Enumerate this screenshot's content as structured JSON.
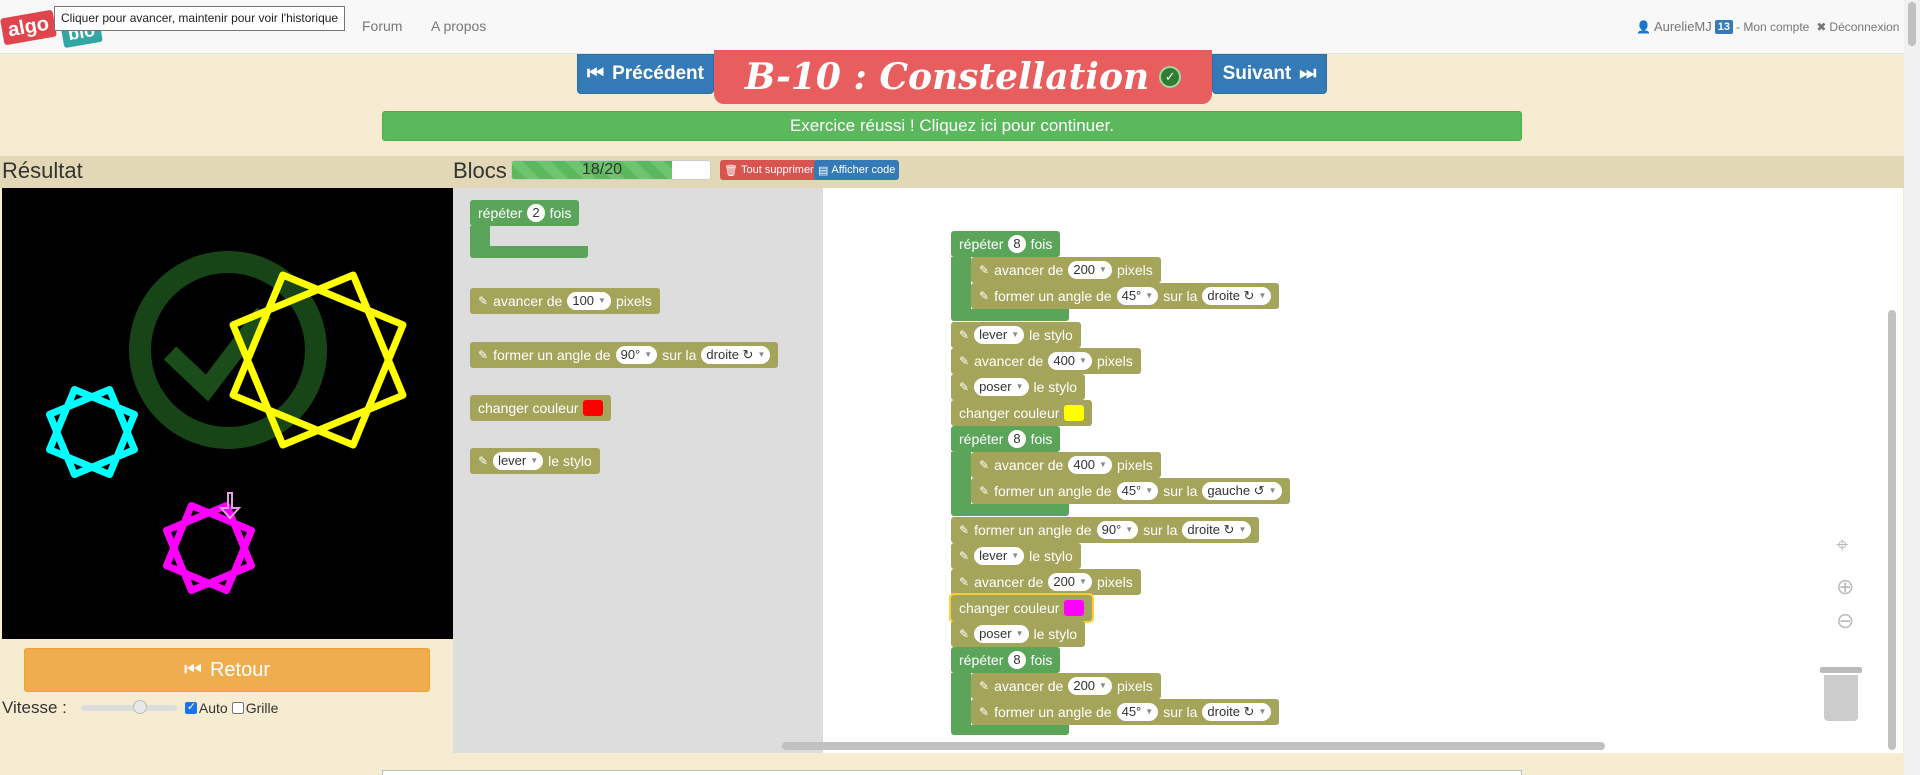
{
  "navbar": {
    "logo_text_1": "algo",
    "logo_text_2": "bio",
    "tooltip": "Cliquer pour avancer, maintenir pour voir l'historique",
    "links": [
      "Forum",
      "A propos"
    ],
    "username": "AurelieMJ",
    "badge": "13",
    "account": "- Mon compte",
    "logout": "Déconnexion"
  },
  "header": {
    "prev": "Précédent",
    "next": "Suivant",
    "title": "B-10 : Constellation",
    "success": "Exercice réussi ! Cliquez ici pour continuer."
  },
  "result": {
    "title": "Résultat",
    "back": "Retour",
    "speed_label": "Vitesse :",
    "auto_label": "Auto",
    "auto_checked": true,
    "grid_label": "Grille",
    "grid_checked": false
  },
  "blocks": {
    "title": "Blocs",
    "progress_text": "18/20",
    "progress_value": 0.9,
    "delete_all": "Tout supprimer",
    "show_code": "Afficher code"
  },
  "toolbox": {
    "repeat": {
      "label": "répéter",
      "count": "2",
      "suffix": "fois"
    },
    "advance": {
      "label": "avancer de",
      "value": "100",
      "unit": "pixels"
    },
    "turn": {
      "label": "former un angle de",
      "angle": "90°",
      "mid": "sur la",
      "dir": "droite ↻"
    },
    "color": {
      "label": "changer couleur",
      "color": "#ff0000"
    },
    "pen": {
      "value": "lever",
      "label": "le stylo"
    }
  },
  "workspace": {
    "r1": {
      "label": "répéter",
      "count": "8",
      "suffix": "fois"
    },
    "r1_adv": {
      "label": "avancer de",
      "value": "200",
      "unit": "pixels"
    },
    "r1_turn": {
      "label": "former un angle de",
      "angle": "45°",
      "mid": "sur la",
      "dir": "droite ↻"
    },
    "pen1": {
      "value": "lever",
      "label": "le stylo"
    },
    "adv1": {
      "label": "avancer de",
      "value": "400",
      "unit": "pixels"
    },
    "pen2": {
      "value": "poser",
      "label": "le stylo"
    },
    "color1": {
      "label": "changer couleur",
      "color": "#ffff00"
    },
    "r2": {
      "label": "répéter",
      "count": "8",
      "suffix": "fois"
    },
    "r2_adv": {
      "label": "avancer de",
      "value": "400",
      "unit": "pixels"
    },
    "r2_turn": {
      "label": "former un angle de",
      "angle": "45°",
      "mid": "sur la",
      "dir": "gauche ↺"
    },
    "turn2": {
      "label": "former un angle de",
      "angle": "90°",
      "mid": "sur la",
      "dir": "droite ↻"
    },
    "pen3": {
      "value": "lever",
      "label": "le stylo"
    },
    "adv2": {
      "label": "avancer de",
      "value": "200",
      "unit": "pixels"
    },
    "color2": {
      "label": "changer couleur",
      "color": "#ff00ff"
    },
    "pen4": {
      "value": "poser",
      "label": "le stylo"
    },
    "r3": {
      "label": "répéter",
      "count": "8",
      "suffix": "fois"
    },
    "r3_adv": {
      "label": "avancer de",
      "value": "200",
      "unit": "pixels"
    },
    "r3_turn": {
      "label": "former un angle de",
      "angle": "45°",
      "mid": "sur la",
      "dir": "droite ↻"
    }
  },
  "colors": {
    "block_olive": "#a4a45b",
    "block_green": "#5ba55b",
    "success": "#5cb85c",
    "primary": "#337ab7",
    "title_red": "#e85d5d",
    "warning": "#f0ad4e",
    "star_cyan": "#00ffff",
    "star_yellow": "#ffff00",
    "star_magenta": "#ff00ff"
  }
}
